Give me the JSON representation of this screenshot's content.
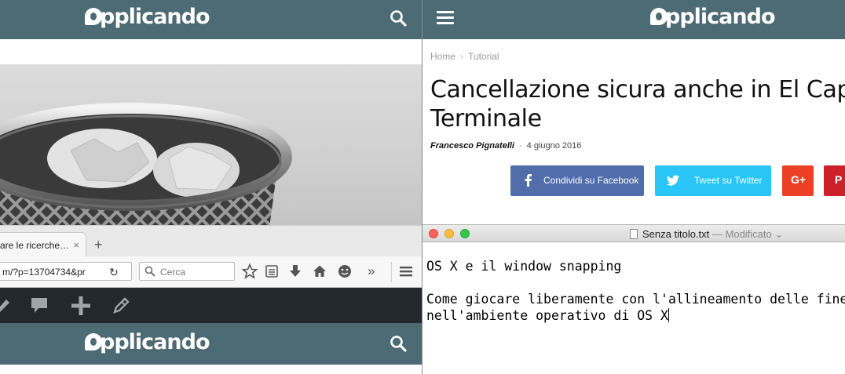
{
  "left": {
    "logo_text": "pplicando",
    "firefox": {
      "tab_title": "are le ricerche…",
      "tab_close": "×",
      "new_tab": "+",
      "url_value": "m/?p=13704734&pr",
      "reload": "↻",
      "search_placeholder": "Cerca",
      "overflow": "»"
    },
    "bottom_logo_text": "pplicando"
  },
  "right": {
    "logo_text": "pplicando",
    "breadcrumb": [
      "Home",
      "Tutorial"
    ],
    "breadcrumb_sep": "›",
    "title_line1": "Cancellazione sicura anche in El Capitan con il",
    "title_line2": "Terminale",
    "author": "Francesco Pignatelli",
    "date": "4 giugno 2016",
    "byline_sep": "-",
    "share": {
      "facebook": "Condividi su Facebook",
      "twitter": "Tweet su Twitter",
      "google": "G+",
      "pinterest": "P"
    },
    "colors": {
      "header": "#4d6b74",
      "facebook": "#516eab",
      "twitter": "#29c5f6",
      "google": "#eb4026",
      "pinterest": "#ca212a"
    },
    "textedit": {
      "filename": "Senza titolo.txt",
      "status": " — Modificato",
      "chevron": "⌄",
      "line1": "OS X e il window snapping",
      "line2": "",
      "line3": "Come giocare liberamente con l'allineamento delle finestre",
      "line4": "nell'ambiente operativo di OS X"
    }
  }
}
